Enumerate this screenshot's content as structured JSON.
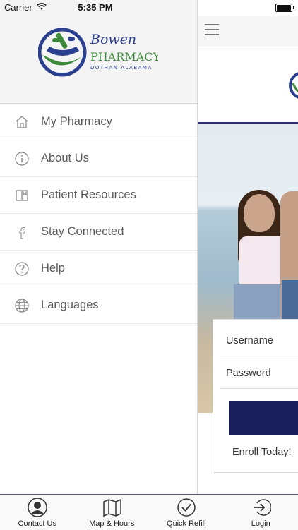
{
  "status_bar": {
    "carrier": "Carrier",
    "time": "5:35 PM"
  },
  "drawer": {
    "logo": {
      "line1": "Bowen",
      "line2": "PHARMACY",
      "line3": "DOTHAN ALABAMA"
    },
    "items": [
      {
        "label": "My Pharmacy",
        "icon": "home-icon"
      },
      {
        "label": "About Us",
        "icon": "info-icon"
      },
      {
        "label": "Patient Resources",
        "icon": "book-icon"
      },
      {
        "label": "Stay Connected",
        "icon": "facebook-icon"
      },
      {
        "label": "Help",
        "icon": "help-icon"
      },
      {
        "label": "Languages",
        "icon": "globe-icon"
      }
    ]
  },
  "login": {
    "username_placeholder": "Username",
    "password_placeholder": "Password",
    "enroll_text": "Enroll Today!"
  },
  "tabbar": {
    "tabs": [
      {
        "label": "Contact Us",
        "icon": "person-icon"
      },
      {
        "label": "Map & Hours",
        "icon": "map-icon"
      },
      {
        "label": "Quick Refill",
        "icon": "checkmark-icon"
      },
      {
        "label": "Login",
        "icon": "login-icon"
      }
    ]
  },
  "colors": {
    "brand_navy": "#1c1f5e",
    "brand_green": "#3d8a3a",
    "brand_blue": "#2b3f8f"
  }
}
